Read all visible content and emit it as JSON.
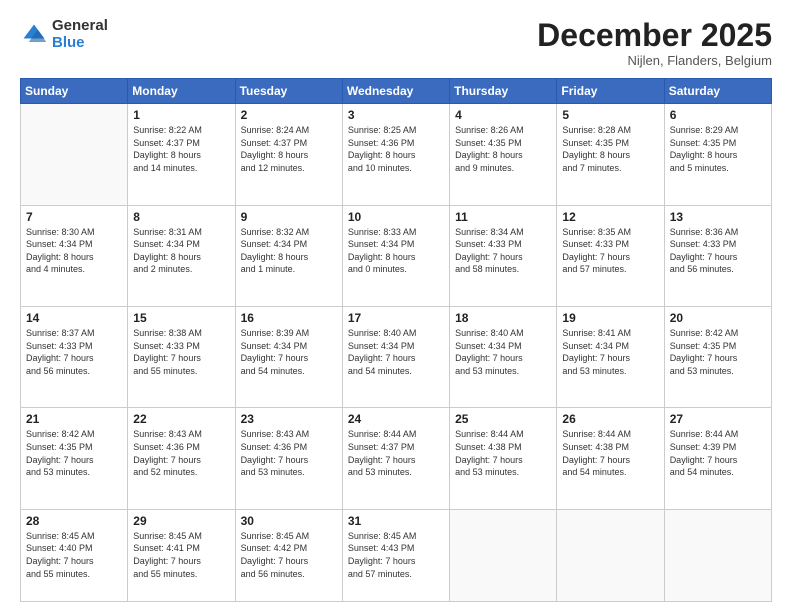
{
  "logo": {
    "general": "General",
    "blue": "Blue"
  },
  "header": {
    "month": "December 2025",
    "location": "Nijlen, Flanders, Belgium"
  },
  "weekdays": [
    "Sunday",
    "Monday",
    "Tuesday",
    "Wednesday",
    "Thursday",
    "Friday",
    "Saturday"
  ],
  "weeks": [
    [
      {
        "date": "",
        "info": ""
      },
      {
        "date": "1",
        "info": "Sunrise: 8:22 AM\nSunset: 4:37 PM\nDaylight: 8 hours\nand 14 minutes."
      },
      {
        "date": "2",
        "info": "Sunrise: 8:24 AM\nSunset: 4:37 PM\nDaylight: 8 hours\nand 12 minutes."
      },
      {
        "date": "3",
        "info": "Sunrise: 8:25 AM\nSunset: 4:36 PM\nDaylight: 8 hours\nand 10 minutes."
      },
      {
        "date": "4",
        "info": "Sunrise: 8:26 AM\nSunset: 4:35 PM\nDaylight: 8 hours\nand 9 minutes."
      },
      {
        "date": "5",
        "info": "Sunrise: 8:28 AM\nSunset: 4:35 PM\nDaylight: 8 hours\nand 7 minutes."
      },
      {
        "date": "6",
        "info": "Sunrise: 8:29 AM\nSunset: 4:35 PM\nDaylight: 8 hours\nand 5 minutes."
      }
    ],
    [
      {
        "date": "7",
        "info": "Sunrise: 8:30 AM\nSunset: 4:34 PM\nDaylight: 8 hours\nand 4 minutes."
      },
      {
        "date": "8",
        "info": "Sunrise: 8:31 AM\nSunset: 4:34 PM\nDaylight: 8 hours\nand 2 minutes."
      },
      {
        "date": "9",
        "info": "Sunrise: 8:32 AM\nSunset: 4:34 PM\nDaylight: 8 hours\nand 1 minute."
      },
      {
        "date": "10",
        "info": "Sunrise: 8:33 AM\nSunset: 4:34 PM\nDaylight: 8 hours\nand 0 minutes."
      },
      {
        "date": "11",
        "info": "Sunrise: 8:34 AM\nSunset: 4:33 PM\nDaylight: 7 hours\nand 58 minutes."
      },
      {
        "date": "12",
        "info": "Sunrise: 8:35 AM\nSunset: 4:33 PM\nDaylight: 7 hours\nand 57 minutes."
      },
      {
        "date": "13",
        "info": "Sunrise: 8:36 AM\nSunset: 4:33 PM\nDaylight: 7 hours\nand 56 minutes."
      }
    ],
    [
      {
        "date": "14",
        "info": "Sunrise: 8:37 AM\nSunset: 4:33 PM\nDaylight: 7 hours\nand 56 minutes."
      },
      {
        "date": "15",
        "info": "Sunrise: 8:38 AM\nSunset: 4:33 PM\nDaylight: 7 hours\nand 55 minutes."
      },
      {
        "date": "16",
        "info": "Sunrise: 8:39 AM\nSunset: 4:34 PM\nDaylight: 7 hours\nand 54 minutes."
      },
      {
        "date": "17",
        "info": "Sunrise: 8:40 AM\nSunset: 4:34 PM\nDaylight: 7 hours\nand 54 minutes."
      },
      {
        "date": "18",
        "info": "Sunrise: 8:40 AM\nSunset: 4:34 PM\nDaylight: 7 hours\nand 53 minutes."
      },
      {
        "date": "19",
        "info": "Sunrise: 8:41 AM\nSunset: 4:34 PM\nDaylight: 7 hours\nand 53 minutes."
      },
      {
        "date": "20",
        "info": "Sunrise: 8:42 AM\nSunset: 4:35 PM\nDaylight: 7 hours\nand 53 minutes."
      }
    ],
    [
      {
        "date": "21",
        "info": "Sunrise: 8:42 AM\nSunset: 4:35 PM\nDaylight: 7 hours\nand 53 minutes."
      },
      {
        "date": "22",
        "info": "Sunrise: 8:43 AM\nSunset: 4:36 PM\nDaylight: 7 hours\nand 52 minutes."
      },
      {
        "date": "23",
        "info": "Sunrise: 8:43 AM\nSunset: 4:36 PM\nDaylight: 7 hours\nand 53 minutes."
      },
      {
        "date": "24",
        "info": "Sunrise: 8:44 AM\nSunset: 4:37 PM\nDaylight: 7 hours\nand 53 minutes."
      },
      {
        "date": "25",
        "info": "Sunrise: 8:44 AM\nSunset: 4:38 PM\nDaylight: 7 hours\nand 53 minutes."
      },
      {
        "date": "26",
        "info": "Sunrise: 8:44 AM\nSunset: 4:38 PM\nDaylight: 7 hours\nand 54 minutes."
      },
      {
        "date": "27",
        "info": "Sunrise: 8:44 AM\nSunset: 4:39 PM\nDaylight: 7 hours\nand 54 minutes."
      }
    ],
    [
      {
        "date": "28",
        "info": "Sunrise: 8:45 AM\nSunset: 4:40 PM\nDaylight: 7 hours\nand 55 minutes."
      },
      {
        "date": "29",
        "info": "Sunrise: 8:45 AM\nSunset: 4:41 PM\nDaylight: 7 hours\nand 55 minutes."
      },
      {
        "date": "30",
        "info": "Sunrise: 8:45 AM\nSunset: 4:42 PM\nDaylight: 7 hours\nand 56 minutes."
      },
      {
        "date": "31",
        "info": "Sunrise: 8:45 AM\nSunset: 4:43 PM\nDaylight: 7 hours\nand 57 minutes."
      },
      {
        "date": "",
        "info": ""
      },
      {
        "date": "",
        "info": ""
      },
      {
        "date": "",
        "info": ""
      }
    ]
  ]
}
